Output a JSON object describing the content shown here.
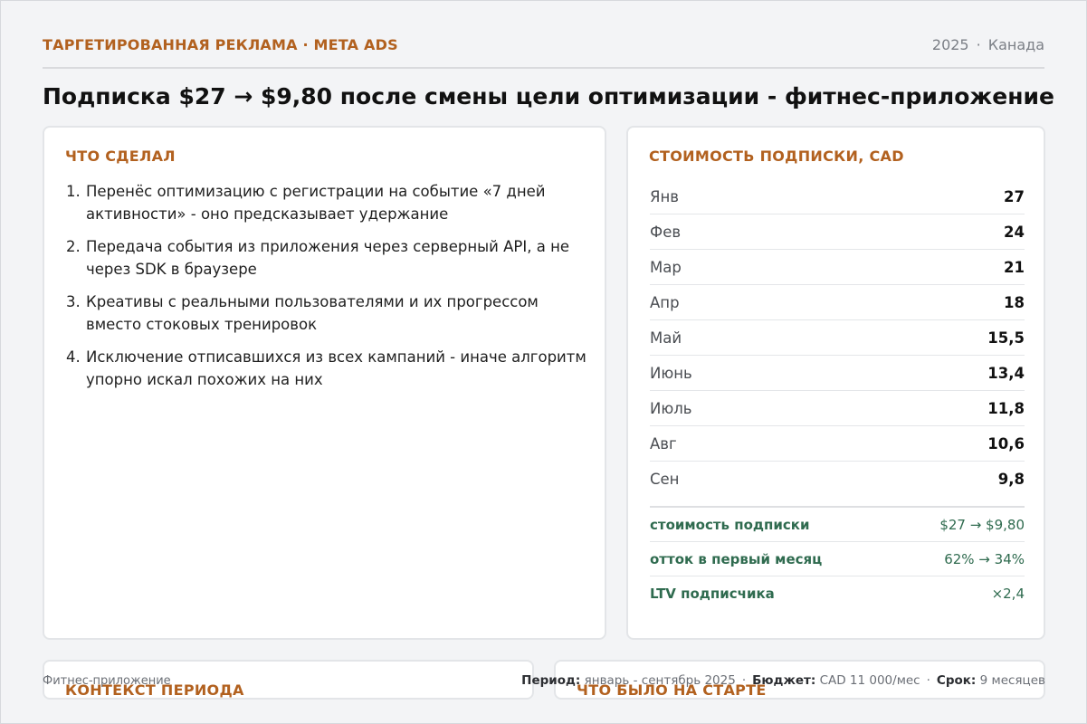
{
  "header": {
    "kicker": "ТАРГЕТИРОВАННАЯ РЕКЛАМА · META ADS",
    "year": "2025",
    "region": "Канада"
  },
  "title": "Подписка $27 → $9,80 после смены цели оптимизации - фитнес-приложение",
  "steps": {
    "heading": "ЧТО СДЕЛАЛ",
    "items": [
      "Перенёс оптимизацию с регистрации на событие «7 дней активности» - оно предсказывает удержание",
      "Передача события из приложения через серверный API, а не через SDK в браузере",
      "Креативы с реальными пользователями и их прогрессом вместо стоковых тренировок",
      "Исключение отписавшихся из всех кампаний - иначе алгоритм упорно искал похожих на них"
    ]
  },
  "cost": {
    "heading": "СТОИМОСТЬ ПОДПИСКИ, CAD",
    "rows": [
      {
        "month": "Янв",
        "value": "27"
      },
      {
        "month": "Фев",
        "value": "24"
      },
      {
        "month": "Мар",
        "value": "21"
      },
      {
        "month": "Апр",
        "value": "18"
      },
      {
        "month": "Май",
        "value": "15,5"
      },
      {
        "month": "Июнь",
        "value": "13,4"
      },
      {
        "month": "Июль",
        "value": "11,8"
      },
      {
        "month": "Авг",
        "value": "10,6"
      },
      {
        "month": "Сен",
        "value": "9,8"
      }
    ],
    "summary": [
      {
        "label": "стоимость подписки",
        "value": "$27 → $9,80"
      },
      {
        "label": "отток в первый месяц",
        "value": "62% → 34%"
      },
      {
        "label": "LTV подписчика",
        "value": "×2,4"
      }
    ]
  },
  "bottom": {
    "context_heading": "КОНТЕКСТ ПЕРИОДА",
    "start_heading": "ЧТО БЫЛО НА СТАРТЕ"
  },
  "footer": {
    "left": "Фитнес-приложение",
    "period_label": "Период:",
    "period_value": "январь - сентябрь 2025",
    "budget_label": "Бюджет:",
    "budget_value": "CAD 11 000/мес",
    "term_label": "Срок:",
    "term_value": "9 месяцев"
  },
  "colors": {
    "accent": "#b2611f",
    "summary_green": "#2f6b4f"
  }
}
